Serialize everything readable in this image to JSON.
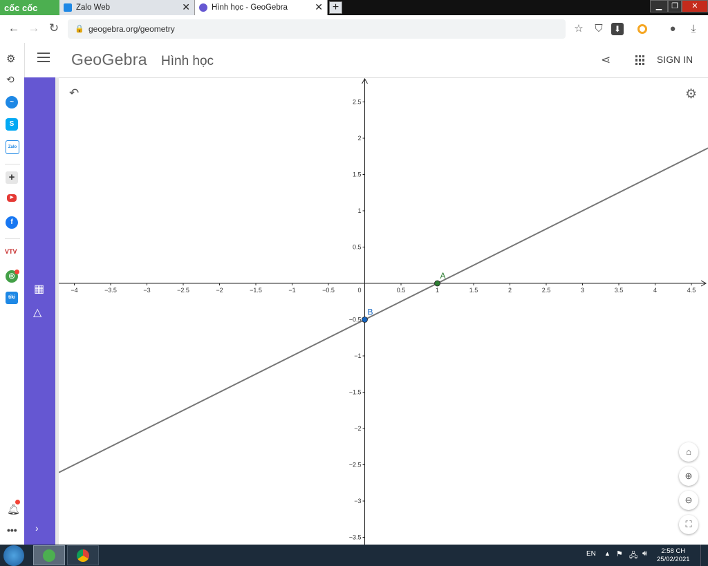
{
  "browser": {
    "brand": "cốc cốc",
    "tabs": [
      {
        "title": "Zalo Web"
      },
      {
        "title": "Hình học - GeoGebra"
      }
    ],
    "new_tab": "+",
    "url": "geogebra.org/geometry"
  },
  "app": {
    "logo": "GeoGebra",
    "title": "Hình học",
    "sign_in": "SIGN IN"
  },
  "graph": {
    "x_ticks": [
      "−4",
      "−3.5",
      "−3",
      "−2.5",
      "−2",
      "−1.5",
      "−1",
      "−0.5",
      "0.5",
      "1",
      "1.5",
      "2",
      "2.5",
      "3",
      "3.5",
      "4",
      "4.5"
    ],
    "y_ticks_pos": [
      "2.5",
      "2",
      "1.5",
      "1",
      "0.5"
    ],
    "y_ticks_neg": [
      "−0.5",
      "−1",
      "−1.5",
      "−2",
      "−2.5",
      "−3",
      "−3.5"
    ],
    "origin": "0",
    "points": [
      {
        "label": "A",
        "x": 1,
        "y": 0,
        "color": "#2e7d32"
      },
      {
        "label": "B",
        "x": 0,
        "y": -0.5,
        "color": "#1565c0"
      }
    ],
    "line": {
      "through": [
        "A",
        "B"
      ],
      "color": "#777777"
    }
  },
  "taskbar": {
    "lang": "EN",
    "time": "2:58 CH",
    "date": "25/02/2021"
  },
  "colors": {
    "panel": "#6557d2",
    "accent_green": "#4caf50"
  }
}
